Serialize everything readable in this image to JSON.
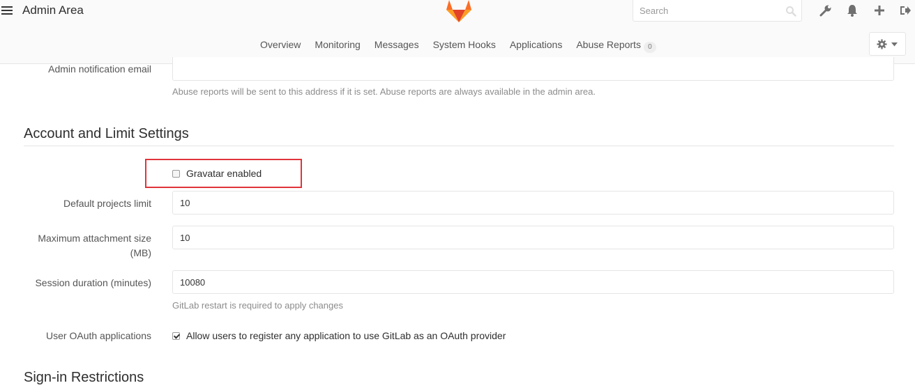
{
  "header": {
    "title": "Admin Area",
    "search_placeholder": "Search",
    "nav": [
      {
        "label": "Overview"
      },
      {
        "label": "Monitoring"
      },
      {
        "label": "Messages"
      },
      {
        "label": "System Hooks"
      },
      {
        "label": "Applications"
      },
      {
        "label": "Abuse Reports",
        "badge": "0"
      }
    ],
    "icons": [
      "wrench-icon",
      "bell-icon",
      "plus-icon",
      "sign-out-icon",
      "gear-icon"
    ]
  },
  "form": {
    "admin_notification_email": {
      "label": "Admin notification email",
      "value": "",
      "help": "Abuse reports will be sent to this address if it is set. Abuse reports are always available in the admin area."
    },
    "account_section_title": "Account and Limit Settings",
    "gravatar": {
      "label": "Gravatar enabled",
      "checked": false
    },
    "default_projects_limit": {
      "label": "Default projects limit",
      "value": "10"
    },
    "max_attachment_size": {
      "label_line1": "Maximum attachment size",
      "label_line2": "(MB)",
      "value": "10"
    },
    "session_duration": {
      "label": "Session duration (minutes)",
      "value": "10080",
      "help": "GitLab restart is required to apply changes"
    },
    "user_oauth": {
      "label": "User OAuth applications",
      "option": "Allow users to register any application to use GitLab as an OAuth provider",
      "checked": true
    },
    "signin_section_title": "Sign-in Restrictions"
  },
  "colors": {
    "accent_highlight": "#e0343a",
    "logo_orange": "#fc6d26",
    "logo_red": "#e24329",
    "logo_light": "#fca326"
  }
}
